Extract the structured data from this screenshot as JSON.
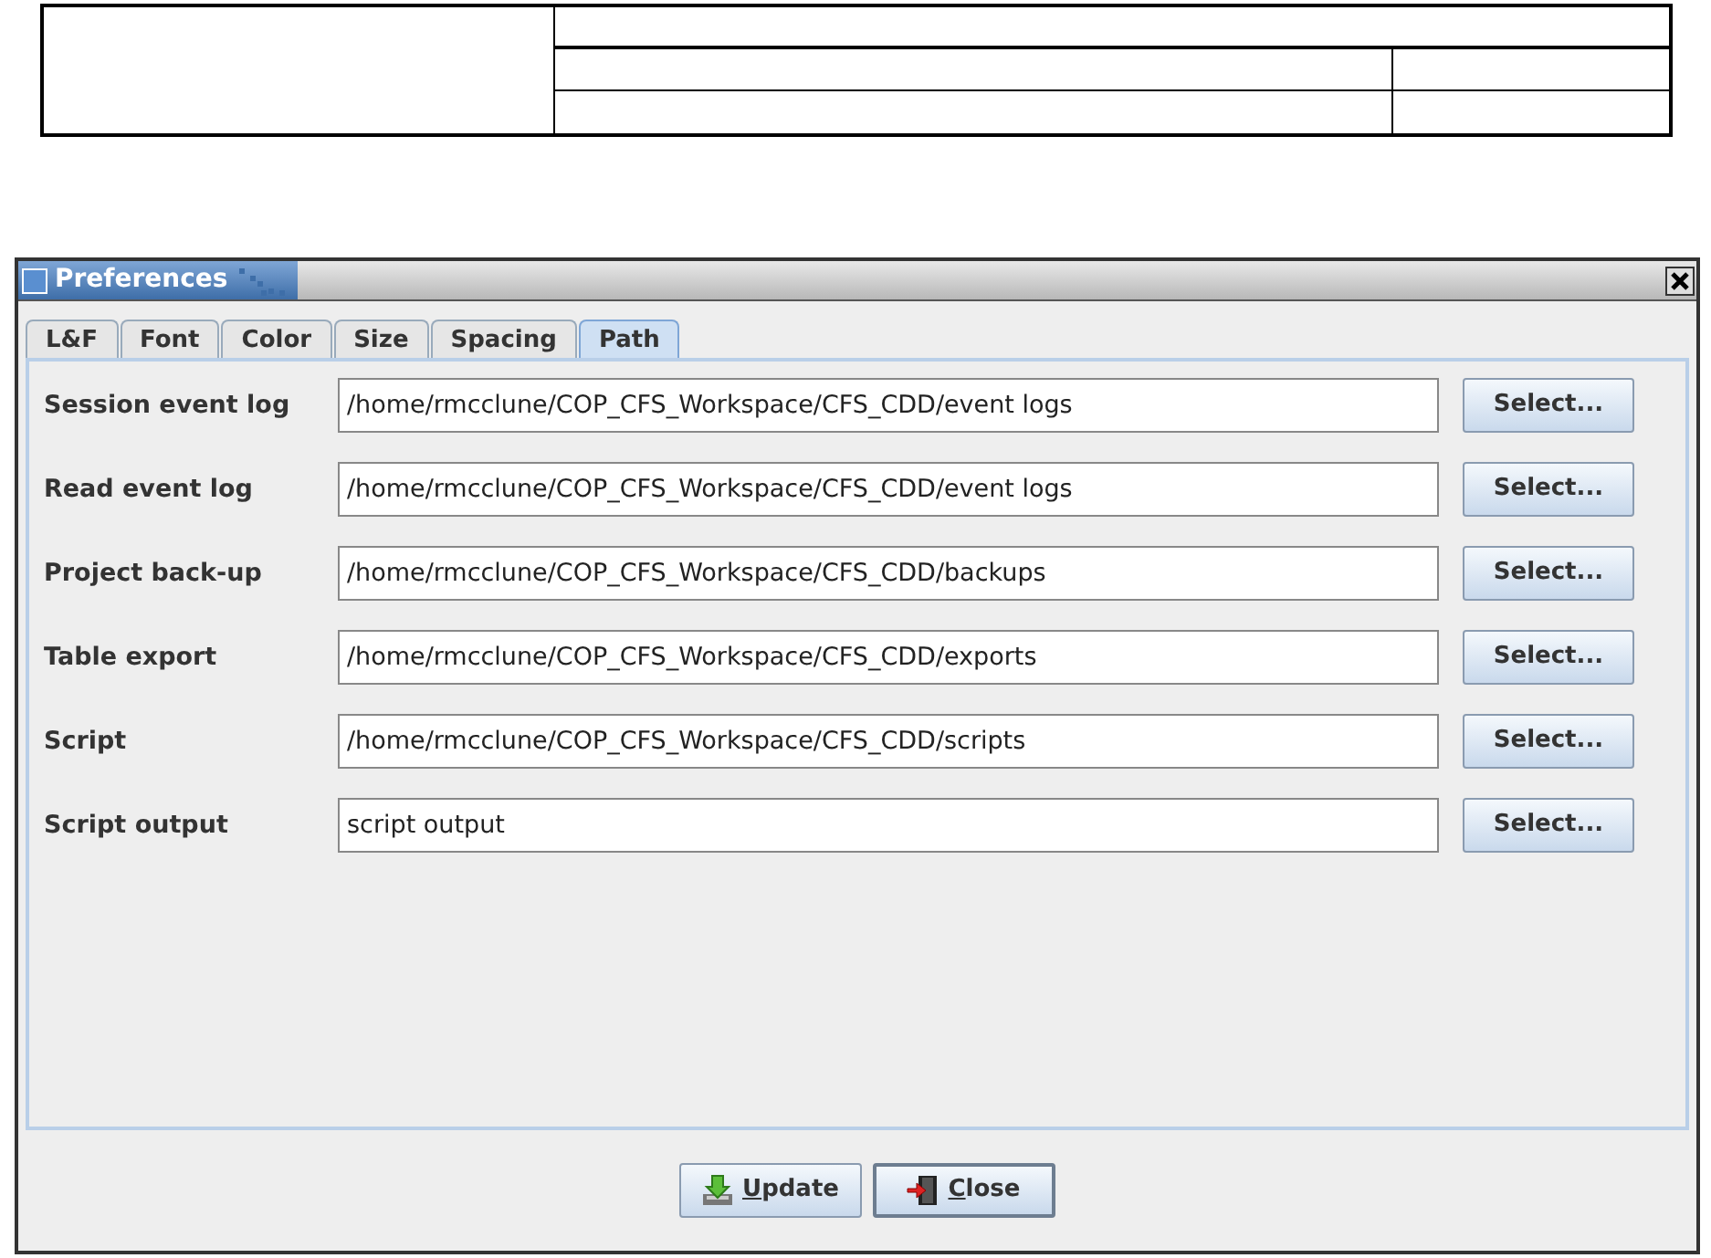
{
  "window": {
    "title": "Preferences"
  },
  "tabs": [
    {
      "label": "L&F",
      "selected": false
    },
    {
      "label": "Font",
      "selected": false
    },
    {
      "label": "Color",
      "selected": false
    },
    {
      "label": "Size",
      "selected": false
    },
    {
      "label": "Spacing",
      "selected": false
    },
    {
      "label": "Path",
      "selected": true
    }
  ],
  "paths": [
    {
      "label": "Session event log",
      "value": "/home/rmcclune/COP_CFS_Workspace/CFS_CDD/event logs",
      "button": "Select..."
    },
    {
      "label": "Read event log",
      "value": "/home/rmcclune/COP_CFS_Workspace/CFS_CDD/event logs",
      "button": "Select..."
    },
    {
      "label": "Project back-up",
      "value": "/home/rmcclune/COP_CFS_Workspace/CFS_CDD/backups",
      "button": "Select..."
    },
    {
      "label": "Table export",
      "value": "/home/rmcclune/COP_CFS_Workspace/CFS_CDD/exports",
      "button": "Select..."
    },
    {
      "label": "Script",
      "value": "/home/rmcclune/COP_CFS_Workspace/CFS_CDD/scripts",
      "button": "Select..."
    },
    {
      "label": "Script output",
      "value": "script output",
      "button": "Select..."
    }
  ],
  "buttons": [
    {
      "kind": "update",
      "label": "Update"
    },
    {
      "kind": "close",
      "label": "Close"
    }
  ]
}
